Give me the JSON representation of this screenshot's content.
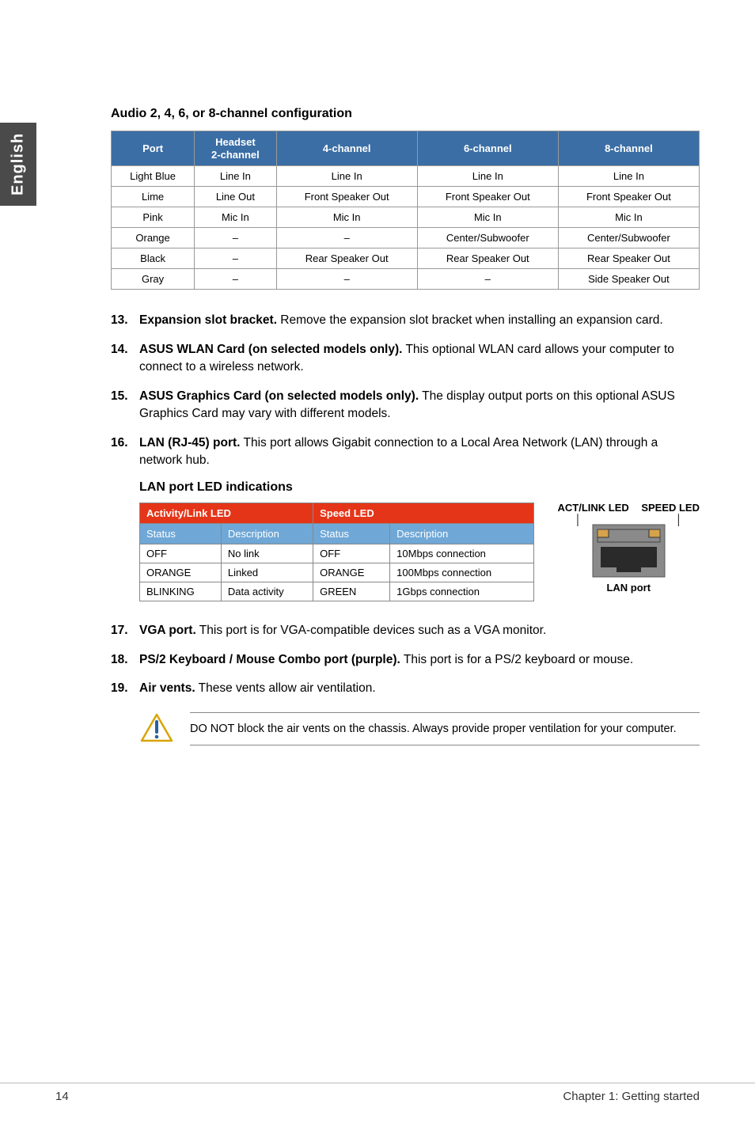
{
  "sideTab": "English",
  "sectionTitle": "Audio 2, 4, 6, or 8-channel configuration",
  "audioTable": {
    "headers": [
      "Port",
      "Headset\n2-channel",
      "4-channel",
      "6-channel",
      "8-channel"
    ],
    "rows": [
      [
        "Light Blue",
        "Line In",
        "Line In",
        "Line In",
        "Line In"
      ],
      [
        "Lime",
        "Line Out",
        "Front Speaker Out",
        "Front Speaker Out",
        "Front Speaker Out"
      ],
      [
        "Pink",
        "Mic In",
        "Mic In",
        "Mic In",
        "Mic In"
      ],
      [
        "Orange",
        "–",
        "–",
        "Center/Subwoofer",
        "Center/Subwoofer"
      ],
      [
        "Black",
        "–",
        "Rear Speaker Out",
        "Rear Speaker Out",
        "Rear Speaker Out"
      ],
      [
        "Gray",
        "–",
        "–",
        "–",
        "Side Speaker Out"
      ]
    ]
  },
  "items1": [
    {
      "num": "13.",
      "lead": "Expansion slot bracket.",
      "text": " Remove the expansion slot bracket when installing an expansion card."
    },
    {
      "num": "14.",
      "lead": "ASUS WLAN Card (on selected models only).",
      "text": " This optional WLAN card allows your computer to connect to a wireless network."
    },
    {
      "num": "15.",
      "lead": "ASUS Graphics Card (on selected models only).",
      "text": " The display output ports on this optional ASUS Graphics Card may vary with different models."
    },
    {
      "num": "16.",
      "lead": "LAN (RJ-45) port.",
      "text": " This port allows Gigabit connection to a Local Area Network (LAN) through a network hub."
    }
  ],
  "lanHeading": "LAN port LED indications",
  "lanTable": {
    "group1": "Activity/Link LED",
    "group2": "Speed LED",
    "sub": [
      "Status",
      "Description",
      "Status",
      "Description"
    ],
    "rows": [
      [
        "OFF",
        "No link",
        "OFF",
        "10Mbps connection"
      ],
      [
        "ORANGE",
        "Linked",
        "ORANGE",
        "100Mbps connection"
      ],
      [
        "BLINKING",
        "Data activity",
        "GREEN",
        "1Gbps connection"
      ]
    ]
  },
  "portLabels": {
    "left": "ACT/LINK LED",
    "right": "SPEED LED",
    "caption": "LAN port"
  },
  "items2": [
    {
      "num": "17.",
      "lead": "VGA port.",
      "text": " This port is for VGA-compatible devices such as a VGA monitor."
    },
    {
      "num": "18.",
      "lead": "PS/2 Keyboard / Mouse Combo port (purple).",
      "text": " This port is for a PS/2 keyboard or mouse."
    },
    {
      "num": "19.",
      "lead": "Air vents.",
      "text": " These vents allow air ventilation."
    }
  ],
  "note": "DO NOT block the air vents on the chassis. Always provide proper ventilation for your computer.",
  "footer": {
    "page": "14",
    "chapter": "Chapter 1: Getting started"
  }
}
